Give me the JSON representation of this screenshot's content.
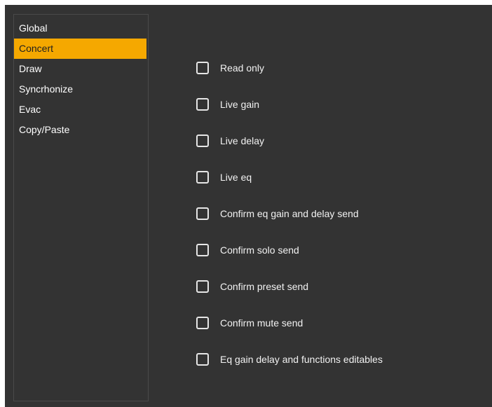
{
  "sidebar": {
    "items": [
      {
        "label": "Global"
      },
      {
        "label": "Concert"
      },
      {
        "label": "Draw"
      },
      {
        "label": "Syncrhonize"
      },
      {
        "label": "Evac"
      },
      {
        "label": "Copy/Paste"
      }
    ],
    "selected_index": 1
  },
  "options": [
    {
      "label": "Read only",
      "checked": false
    },
    {
      "label": "Live gain",
      "checked": false
    },
    {
      "label": "Live delay",
      "checked": false
    },
    {
      "label": "Live eq",
      "checked": false
    },
    {
      "label": "Confirm eq gain and delay send",
      "checked": false
    },
    {
      "label": "Confirm solo send",
      "checked": false
    },
    {
      "label": "Confirm preset send",
      "checked": false
    },
    {
      "label": "Confirm mute send",
      "checked": false
    },
    {
      "label": "Eq gain delay and functions editables",
      "checked": false
    }
  ],
  "colors": {
    "background": "#333333",
    "accent": "#f5a800",
    "text": "#ffffff"
  }
}
